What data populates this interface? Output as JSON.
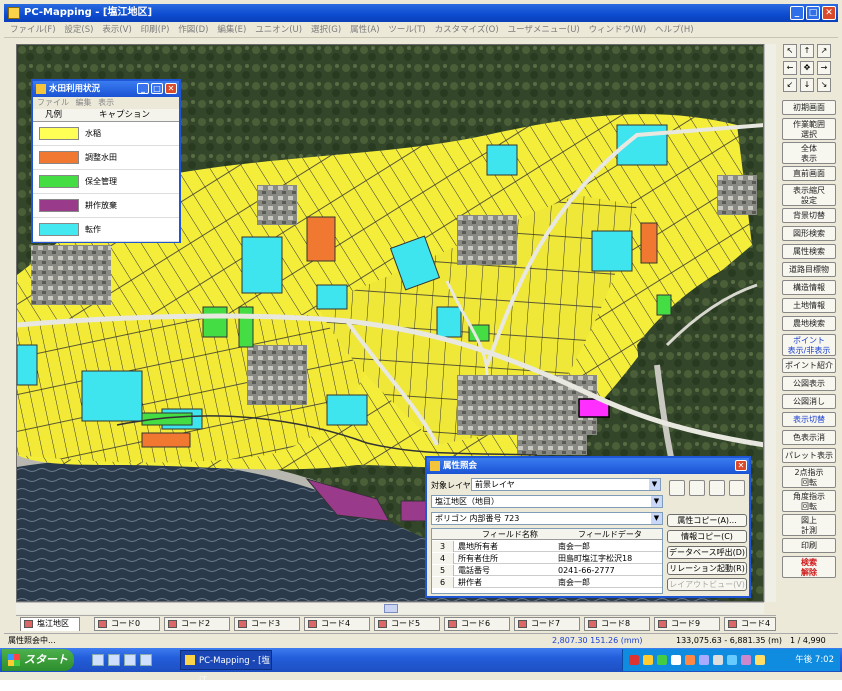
{
  "window": {
    "title": "PC-Mapping - [塩江地区]"
  },
  "menu": [
    "ファイル(F)",
    "設定(S)",
    "表示(V)",
    "印刷(P)",
    "作図(D)",
    "編集(E)",
    "ユニオン(U)",
    "選択(G)",
    "属性(A)",
    "ツール(T)",
    "カスタマイズ(O)",
    "ユーザメニュー(U)",
    "ウィンドウ(W)",
    "ヘルプ(H)"
  ],
  "legend": {
    "title": "水田利用状況",
    "menu": [
      "ファイル",
      "編集",
      "表示"
    ],
    "col_legend": "凡例",
    "col_caption": "キャプション",
    "items": [
      {
        "label": "水稲",
        "color": "#ffff55"
      },
      {
        "label": "調整水田",
        "color": "#f07830"
      },
      {
        "label": "保全管理",
        "color": "#44dd44"
      },
      {
        "label": "耕作放棄",
        "color": "#9a3a8a"
      },
      {
        "label": "転作",
        "color": "#44e8f0"
      }
    ]
  },
  "attr": {
    "title": "属性照会",
    "target_label": "対象レイヤ",
    "target_value": "前景レイヤ",
    "layer_value": "塩江地区（地目）",
    "polygon_value": "ポリゴン 内部番号 723",
    "col_field": "フィールド名称",
    "col_data": "フィールドデータ",
    "rows": [
      {
        "no": "3",
        "field": "農地所有者",
        "value": "南会一郎"
      },
      {
        "no": "4",
        "field": "所有者住所",
        "value": "田島町塩江字松沢18"
      },
      {
        "no": "5",
        "field": "電話番号",
        "value": "0241-66-2777"
      },
      {
        "no": "6",
        "field": "耕作者",
        "value": "南会一郎"
      }
    ],
    "buttons": {
      "copy": "属性コピー(A)...",
      "info_copy": "情報コピー(C)",
      "db_call": "データベース呼出(D)",
      "relation": "リレーション起動(R)",
      "layout_view": "レイアウトビュー(V)"
    }
  },
  "right_panel": [
    "初期画面",
    "作業範囲\n選択",
    "全体\n表示",
    "直前画面",
    "表示縮尺\n設定",
    "背景切替",
    "図形検索",
    "属性検索",
    "道路目標物",
    "構造情報",
    "土地情報",
    "農地検索",
    "ポイント\n表示/非表示",
    "ポイント紹介",
    "公図表示",
    "公図消し",
    "表示切替",
    "色表示消",
    "パレット表示",
    "2点指示\n回転",
    "角度指示\n回転",
    "図上\n計測",
    "印刷",
    "検索\n解除"
  ],
  "tabs": [
    "塩江地区",
    "コード0",
    "コード2",
    "コード3",
    "コード4",
    "コード5",
    "コード6",
    "コード7",
    "コード8",
    "コード9",
    "コード4"
  ],
  "status": {
    "message": "属性照会中...",
    "screen_coords": "2,807.30 151.26 (mm)",
    "world_coords": "133,075.63 - 6,881.35 (m)",
    "scale": "1 / 4,990"
  },
  "taskbar": {
    "start": "スタート",
    "item": "PC-Mapping - [塩江...",
    "clock": "午後 7:02"
  }
}
